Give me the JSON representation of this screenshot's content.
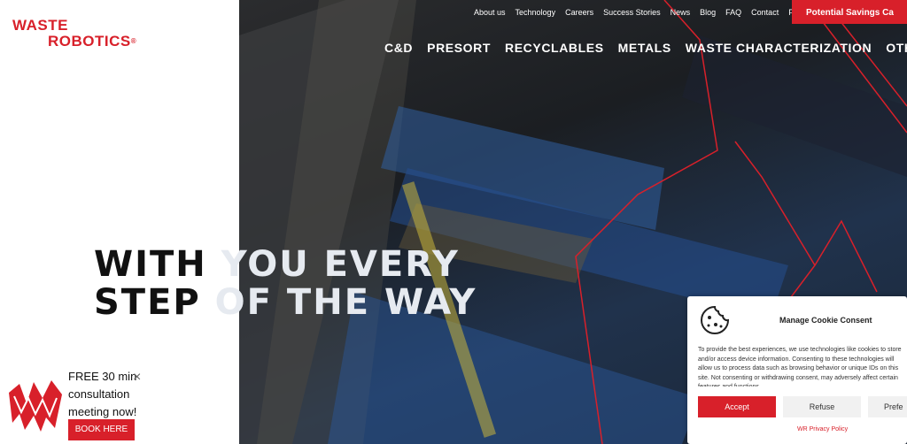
{
  "brand": {
    "line1": "WASTE",
    "line2": "ROBOTICS",
    "reg": "®"
  },
  "top_nav": [
    "About us",
    "Technology",
    "Careers",
    "Success Stories",
    "News",
    "Blog",
    "FAQ",
    "Contact",
    "FR"
  ],
  "top_cta": "Potential Savings Ca",
  "main_nav": [
    "C&D",
    "PRESORT",
    "RECYCLABLES",
    "METALS",
    "WASTE CHARACTERIZATION",
    "OTH"
  ],
  "headline": {
    "dark1": "WITH ",
    "light1": "YOU EVERY",
    "dark2": "STEP ",
    "light2": "OF THE WAY"
  },
  "consult": {
    "text": "FREE 30 min consultation meeting now!",
    "close": "×",
    "button": "BOOK HERE"
  },
  "cookie": {
    "title": "Manage Cookie Consent",
    "body": "To provide the best experiences, we use technologies like cookies to store and/or access device information. Consenting to these technologies will allow us to process data such as browsing behavior or unique IDs on this site. Not consenting or withdrawing consent, may adversely affect certain features and functions.",
    "accept": "Accept",
    "refuse": "Refuse",
    "prefs": "Prefe",
    "privacy": "WR Privacy Policy"
  },
  "colors": {
    "accent": "#d8202a"
  }
}
